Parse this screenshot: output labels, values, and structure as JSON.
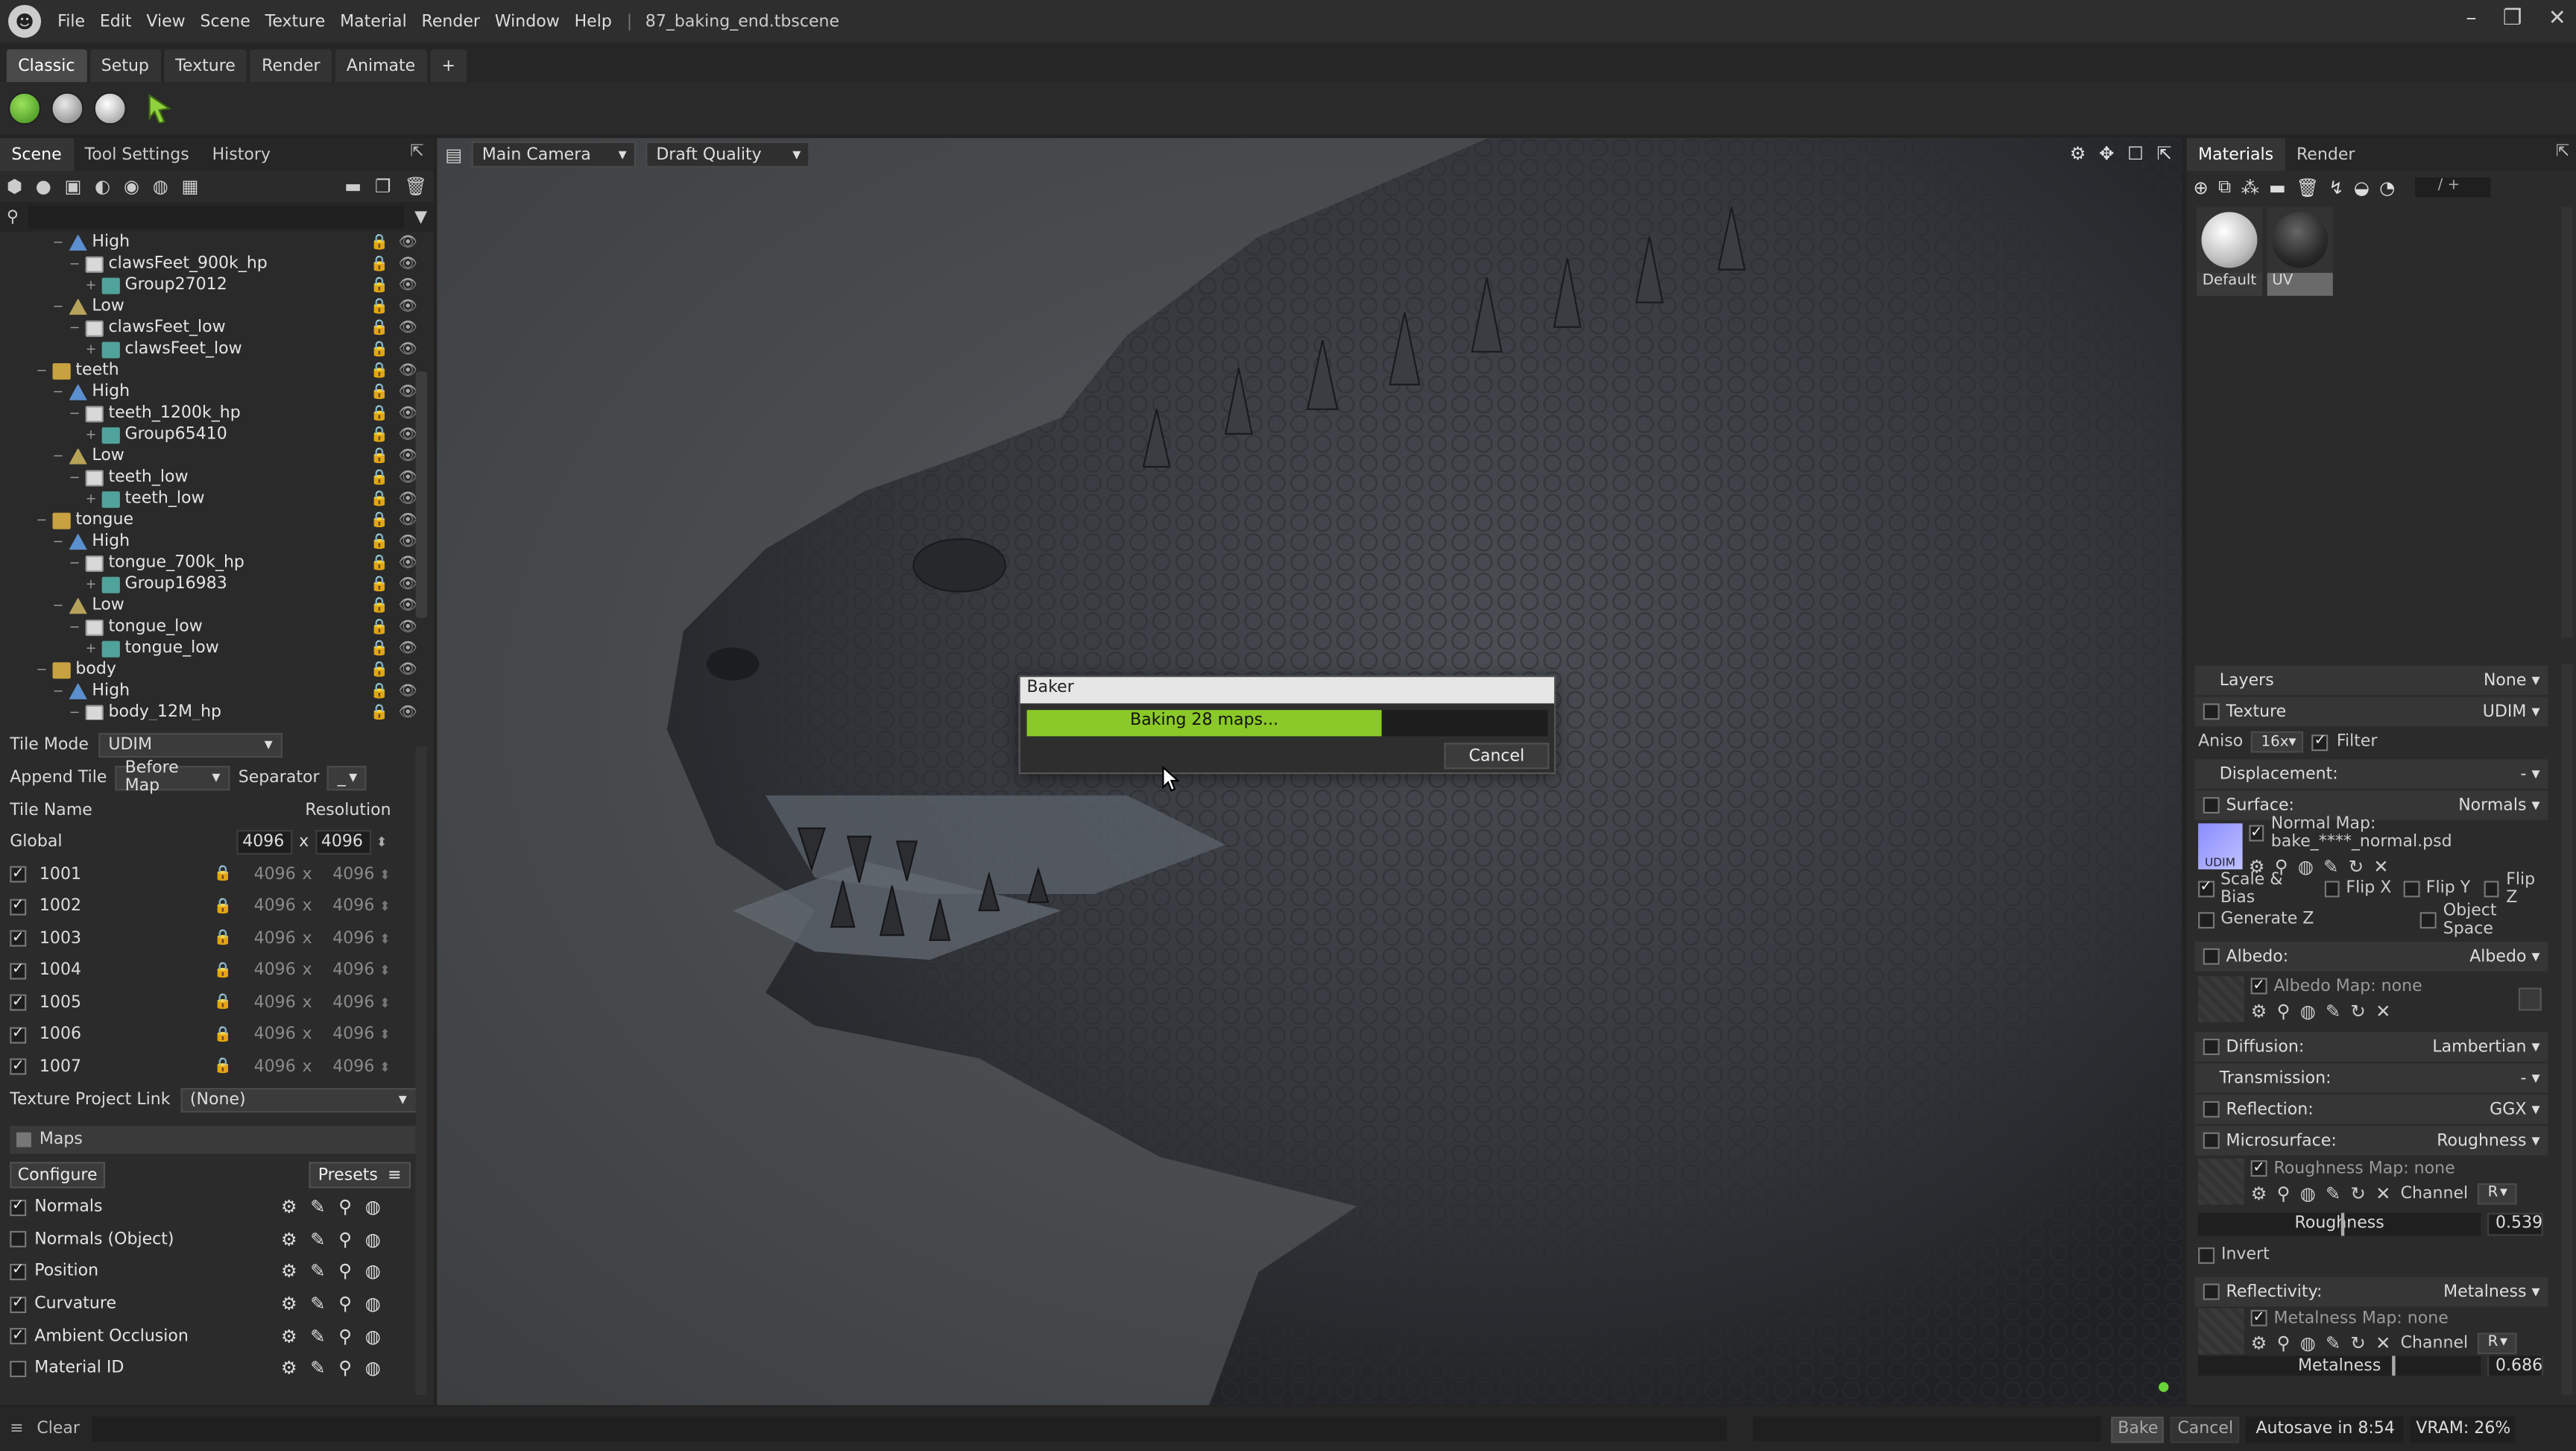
{
  "app": {
    "filename": "87_baking_end.tbscene"
  },
  "menu": [
    "File",
    "Edit",
    "View",
    "Scene",
    "Texture",
    "Material",
    "Render",
    "Window",
    "Help"
  ],
  "workspace_tabs": [
    "Classic",
    "Setup",
    "Texture",
    "Render",
    "Animate",
    "+"
  ],
  "left_tabs": [
    "Scene",
    "Tool Settings",
    "History"
  ],
  "scene_tree": [
    {
      "label": "High",
      "type": "grp",
      "indent": 1
    },
    {
      "label": "clawsFeet_900k_hp",
      "type": "doc",
      "indent": 2
    },
    {
      "label": "Group27012",
      "type": "mesh",
      "indent": 3
    },
    {
      "label": "Low",
      "type": "low",
      "indent": 1
    },
    {
      "label": "clawsFeet_low",
      "type": "doc",
      "indent": 2
    },
    {
      "label": "clawsFeet_low",
      "type": "mesh",
      "indent": 3
    },
    {
      "label": "teeth",
      "type": "fold",
      "indent": 0
    },
    {
      "label": "High",
      "type": "grp",
      "indent": 1
    },
    {
      "label": "teeth_1200k_hp",
      "type": "doc",
      "indent": 2
    },
    {
      "label": "Group65410",
      "type": "mesh",
      "indent": 3
    },
    {
      "label": "Low",
      "type": "low",
      "indent": 1
    },
    {
      "label": "teeth_low",
      "type": "doc",
      "indent": 2
    },
    {
      "label": "teeth_low",
      "type": "mesh",
      "indent": 3
    },
    {
      "label": "tongue",
      "type": "fold",
      "indent": 0
    },
    {
      "label": "High",
      "type": "grp",
      "indent": 1
    },
    {
      "label": "tongue_700k_hp",
      "type": "doc",
      "indent": 2
    },
    {
      "label": "Group16983",
      "type": "mesh",
      "indent": 3
    },
    {
      "label": "Low",
      "type": "low",
      "indent": 1
    },
    {
      "label": "tongue_low",
      "type": "doc",
      "indent": 2
    },
    {
      "label": "tongue_low",
      "type": "mesh",
      "indent": 3
    },
    {
      "label": "body",
      "type": "fold",
      "indent": 0
    },
    {
      "label": "High",
      "type": "grp",
      "indent": 1
    },
    {
      "label": "body_12M_hp",
      "type": "doc",
      "indent": 2
    }
  ],
  "bake": {
    "tile_mode_label": "Tile Mode",
    "tile_mode": "UDIM",
    "append_tile_label": "Append Tile",
    "append_tile": "Before Map",
    "separator_label": "Separator",
    "separator": "_",
    "tile_name_header": "Tile Name",
    "resolution_header": "Resolution",
    "global_label": "Global",
    "global_w": "4096",
    "global_h": "4096",
    "x": "x",
    "tiles": [
      {
        "name": "1001",
        "w": "4096",
        "h": "4096"
      },
      {
        "name": "1002",
        "w": "4096",
        "h": "4096"
      },
      {
        "name": "1003",
        "w": "4096",
        "h": "4096"
      },
      {
        "name": "1004",
        "w": "4096",
        "h": "4096"
      },
      {
        "name": "1005",
        "w": "4096",
        "h": "4096"
      },
      {
        "name": "1006",
        "w": "4096",
        "h": "4096"
      },
      {
        "name": "1007",
        "w": "4096",
        "h": "4096"
      }
    ],
    "project_link_label": "Texture Project Link",
    "project_link": "(None)",
    "maps_title": "Maps",
    "configure": "Configure",
    "presets": "Presets",
    "maps": [
      {
        "name": "Normals",
        "checked": true
      },
      {
        "name": "Normals (Object)",
        "checked": false
      },
      {
        "name": "Position",
        "checked": true
      },
      {
        "name": "Curvature",
        "checked": true
      },
      {
        "name": "Ambient Occlusion",
        "checked": true
      },
      {
        "name": "Material ID",
        "checked": false
      }
    ]
  },
  "viewport": {
    "camera": "Main Camera",
    "quality": "Draft Quality"
  },
  "baker_dialog": {
    "title": "Baker",
    "progress_text": "Baking 28 maps...",
    "progress": 0.68,
    "cancel": "Cancel"
  },
  "right_tabs": [
    "Materials",
    "Render"
  ],
  "slider_label": "/ +",
  "materials": [
    {
      "name": "Default"
    },
    {
      "name": "UV"
    }
  ],
  "props": {
    "layers_label": "Layers",
    "layers": "None",
    "texture_label": "Texture",
    "texture": "UDIM",
    "aniso_label": "Aniso",
    "aniso": "16x",
    "filter_label": "Filter",
    "displacement_label": "Displacement:",
    "displacement": "-",
    "surface_label": "Surface:",
    "surface": "Normals",
    "normal_map": "Normal Map: bake_****_normal.psd",
    "udim_tag": "UDIM",
    "scale_bias": "Scale & Bias",
    "flip_x": "Flip X",
    "flip_y": "Flip Y",
    "flip_z": "Flip Z",
    "generate_z": "Generate Z",
    "object_space": "Object Space",
    "albedo_label": "Albedo:",
    "albedo": "Albedo",
    "albedo_map": "Albedo Map: none",
    "diffusion_label": "Diffusion:",
    "diffusion": "Lambertian",
    "transmission_label": "Transmission:",
    "transmission": "-",
    "reflection_label": "Reflection:",
    "reflection": "GGX",
    "microsurface_label": "Microsurface:",
    "microsurface": "Roughness",
    "roughness_map": "Roughness Map: none",
    "channel_label": "Channel",
    "channel": "R",
    "roughness_label": "Roughness",
    "roughness_value": "0.539",
    "invert": "Invert",
    "reflectivity_label": "Reflectivity:",
    "reflectivity": "Metalness",
    "metalness_map": "Metalness Map: none",
    "metalness_label": "Metalness",
    "metalness_value": "0.686"
  },
  "status": {
    "clear": "Clear",
    "bake": "Bake",
    "cancel": "Cancel",
    "autosave": "Autosave in 8:54",
    "vram": "VRAM: 26%"
  }
}
